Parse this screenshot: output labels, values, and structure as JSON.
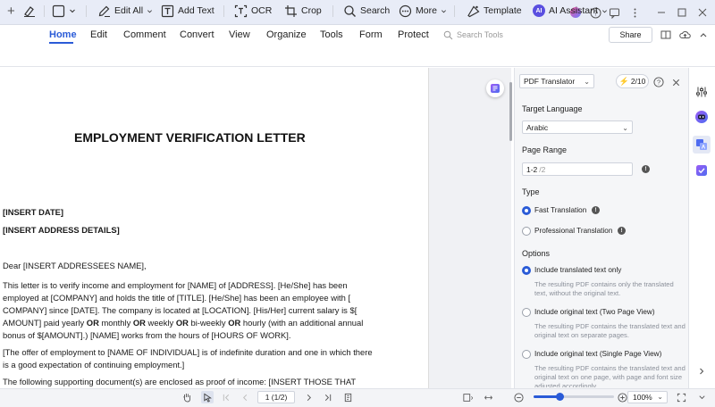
{
  "titlebar": {
    "new_tab": "+"
  },
  "menu": {
    "items": [
      "Home",
      "Edit",
      "Comment",
      "Convert",
      "View",
      "Organize",
      "Tools",
      "Form",
      "Protect"
    ],
    "active": "Home",
    "search_placeholder": "Search Tools",
    "share": "Share"
  },
  "toolbar": {
    "edit_all": "Edit All",
    "add_text": "Add Text",
    "ocr": "OCR",
    "crop": "Crop",
    "search": "Search",
    "more": "More",
    "template": "Template",
    "ai_assistant": "AI Assistant",
    "ai_badge": "AI"
  },
  "document": {
    "title": "EMPLOYMENT VERIFICATION LETTER",
    "insert_date": "[INSERT DATE]",
    "insert_address": "[INSERT ADDRESS DETAILS]",
    "salutation": "Dear [INSERT ADDRESSEES NAME],",
    "p1_l1": "This letter is to verify income and employment for [NAME] of [ADDRESS]. [He/She] has been",
    "p1_l2": "employed at [COMPANY] and holds the title of [TITLE]. [He/She] has been an employee with [",
    "p1_l3": "COMPANY] since [DATE]. The company is located at [LOCATION]. [His/Her] current salary is $[",
    "p1_l4_a": "AMOUNT] paid yearly ",
    "p1_l4_or1": "OR",
    "p1_l4_b": " monthly ",
    "p1_l4_or2": "OR",
    "p1_l4_c": " weekly ",
    "p1_l4_or3": "OR",
    "p1_l4_d": " bi-weekly ",
    "p1_l4_or4": "OR",
    "p1_l4_e": " hourly (with an additional annual",
    "p1_l5": "bonus of $[AMOUNT].) [NAME] works from the hours of [HOURS OF WORK].",
    "p2_l1": "[The offer of employment to [NAME OF INDIVIDUAL] is of indefinite duration and one in which there",
    "p2_l2": "is a good expectation of continuing employment.]",
    "p3_l1": "The following supporting document(s) are enclosed as proof of income: [INSERT THOSE THAT"
  },
  "panel": {
    "tool_select": "PDF Translator",
    "credits": "2/10",
    "target_language_label": "Target Language",
    "target_language": "Arabic",
    "page_range_label": "Page Range",
    "page_range_value": "1-2",
    "page_range_total": "/2",
    "type_label": "Type",
    "type_fast": "Fast Translation",
    "type_pro": "Professional Translation",
    "options_label": "Options",
    "opt1": "Include translated text only",
    "opt1_desc": "The resulting PDF contains only the translated text, without the original text.",
    "opt2": "Include original text (Two Page View)",
    "opt2_desc": "The resulting PDF contains the translated text and original text on separate pages.",
    "opt3": "Include original text (Single Page View)",
    "opt3_desc": "The resulting PDF contains the translated text and original text on one page, with page and font size adjusted accordingly."
  },
  "status": {
    "page_indicator": "1 (1/2)",
    "zoom": "100%",
    "zoom_fraction": 0.32
  },
  "colors": {
    "accent": "#2a5bd7",
    "ai": "#5a4fe0"
  }
}
